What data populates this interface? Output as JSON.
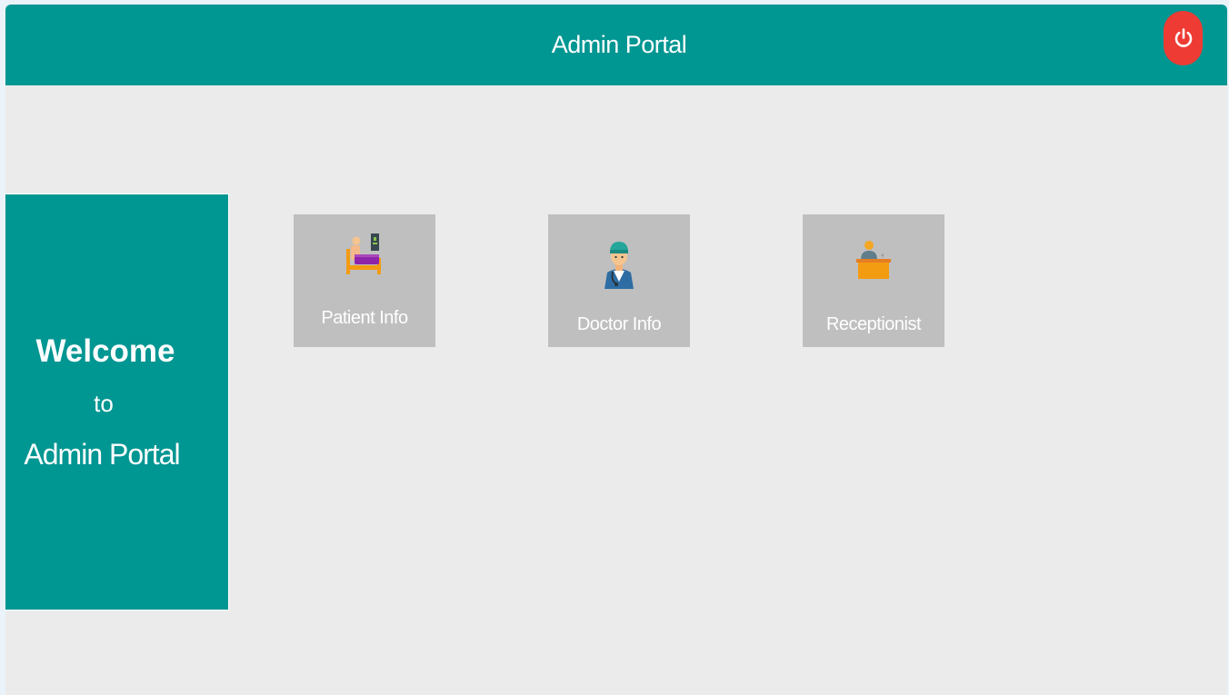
{
  "header": {
    "title": "Admin Portal",
    "logout_icon": "power-icon"
  },
  "welcome": {
    "line1": "Welcome",
    "line2": "to",
    "line3": "Admin Portal"
  },
  "tiles": [
    {
      "label": "Patient Info",
      "icon": "patient-bed-icon"
    },
    {
      "label": "Doctor Info",
      "icon": "doctor-icon"
    },
    {
      "label": "Receptionist",
      "icon": "receptionist-icon"
    }
  ],
  "colors": {
    "primary": "#009692",
    "background": "#ebebeb",
    "tile": "#bfbfbf",
    "logout": "#ee3b33"
  }
}
